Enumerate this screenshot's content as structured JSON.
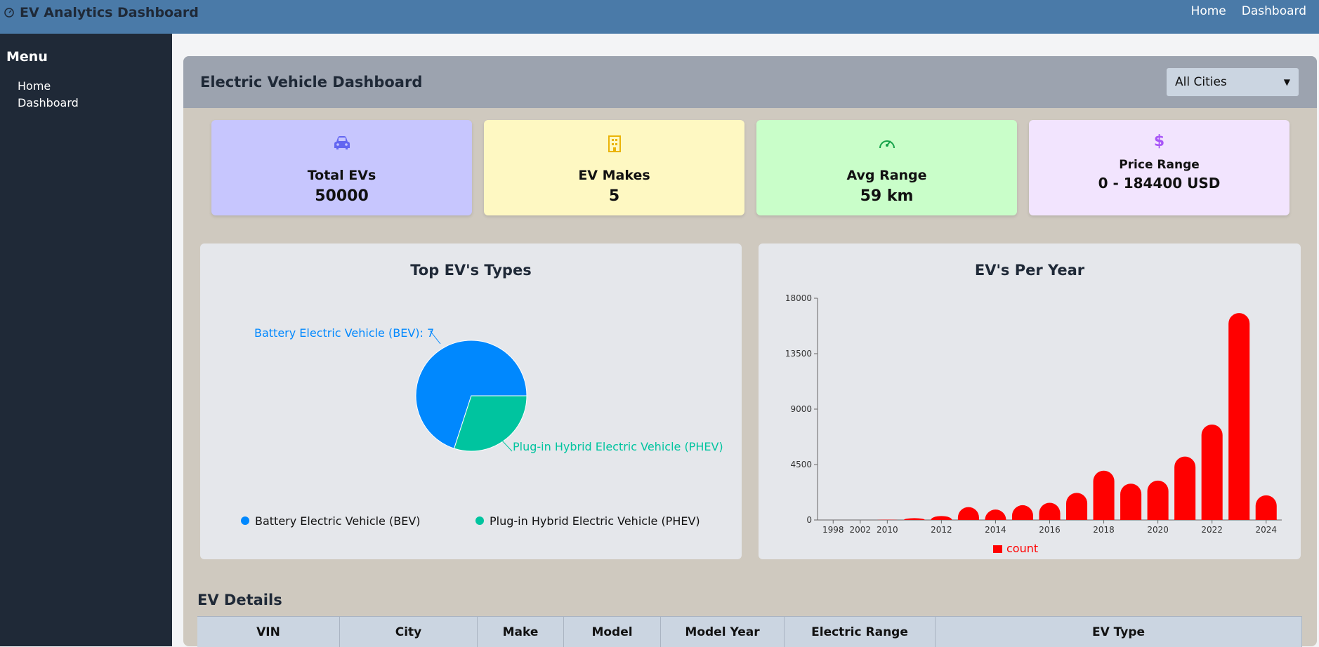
{
  "app": {
    "brand": "EV Analytics Dashboard",
    "nav": [
      "Home",
      "Dashboard"
    ]
  },
  "sidebar": {
    "title": "Menu",
    "items": [
      "Home",
      "Dashboard"
    ]
  },
  "header": {
    "title": "Electric Vehicle Dashboard",
    "city_filter": "All Cities"
  },
  "stats": [
    {
      "label": "Total EVs",
      "value": "50000",
      "icon": "car-icon",
      "color": "#c7c6fe",
      "accent": "#6366f1"
    },
    {
      "label": "EV Makes",
      "value": "5",
      "icon": "building-icon",
      "color": "#fef8c2",
      "accent": "#eab308"
    },
    {
      "label": "Avg Range",
      "value": "59 km",
      "icon": "speedometer-icon",
      "color": "#c9fec9",
      "accent": "#16a34a"
    },
    {
      "label": "Price Range",
      "value": "0 - 184400 USD",
      "icon": "dollar-icon",
      "color": "#f2e4fe",
      "accent": "#a855f7"
    }
  ],
  "pie_card": {
    "title": "Top EV's Types"
  },
  "bar_card": {
    "title": "EV's Per Year"
  },
  "details": {
    "title": "EV Details",
    "columns": [
      "VIN",
      "City",
      "Make",
      "Model",
      "Model Year",
      "Electric Range",
      "EV Type"
    ]
  },
  "chart_data": [
    {
      "type": "pie",
      "title": "Top EV's Types",
      "slices": [
        {
          "name": "Battery Electric Vehicle (BEV)",
          "value": 70,
          "color": "#0088fe"
        },
        {
          "name": "Plug-in Hybrid Electric Vehicle (PHEV)",
          "value": 30,
          "color": "#00c49f"
        }
      ],
      "visible_labels": [
        "Battery Electric Vehicle (BEV): 7",
        "Plug-in Hybrid Electric Vehicle (PHEV)"
      ],
      "legend": "bottom"
    },
    {
      "type": "bar",
      "title": "EV's Per Year",
      "categories": [
        "1998",
        "2002",
        "2010",
        "2011",
        "2012",
        "2013",
        "2014",
        "2015",
        "2016",
        "2017",
        "2018",
        "2019",
        "2020",
        "2021",
        "2022",
        "2023",
        "2024"
      ],
      "x_tick_labels": [
        "1998",
        "2002",
        "2010",
        "2012",
        "2014",
        "2016",
        "2018",
        "2020",
        "2022",
        "2024"
      ],
      "series": [
        {
          "name": "count",
          "color": "#ff0000",
          "values": [
            0,
            0,
            20,
            150,
            320,
            1050,
            850,
            1200,
            1400,
            2200,
            4000,
            2950,
            3200,
            5150,
            7750,
            16800,
            2000
          ]
        }
      ],
      "ylim": [
        0,
        18000
      ],
      "yticks": [
        "0",
        "4500",
        "9000",
        "13500",
        "18000"
      ],
      "legend": "bottom"
    }
  ]
}
